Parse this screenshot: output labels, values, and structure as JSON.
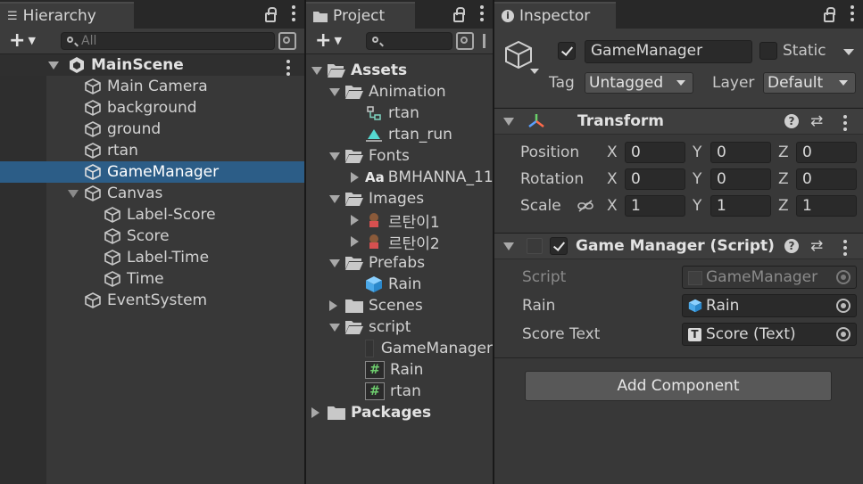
{
  "hierarchy": {
    "tab_title": "Hierarchy",
    "search_placeholder": "All",
    "scene": "MainScene",
    "items": [
      "Main Camera",
      "background",
      "ground",
      "rtan",
      "GameManager",
      "Canvas",
      "Label-Score",
      "Score",
      "Label-Time",
      "Time",
      "EventSystem"
    ],
    "selected": "GameManager",
    "selection_color": "#2c5d87"
  },
  "project": {
    "tab_title": "Project",
    "search_placeholder": "",
    "items": [
      "Assets",
      "Animation",
      "rtan",
      "rtan_run",
      "Fonts",
      "BMHANNA_11",
      "Images",
      "르탄이1",
      "르탄이2",
      "Prefabs",
      "Rain",
      "Scenes",
      "script",
      "GameManager",
      "Rain",
      "rtan",
      "Packages"
    ],
    "font_icon": "Aa"
  },
  "inspector": {
    "tab_title": "Inspector",
    "object_name": "GameManager",
    "static_label": "Static",
    "tag_label": "Tag",
    "tag_value": "Untagged",
    "layer_label": "Layer",
    "layer_value": "Default",
    "transform": {
      "title": "Transform",
      "position_label": "Position",
      "rotation_label": "Rotation",
      "scale_label": "Scale",
      "axis_x": "X",
      "axis_y": "Y",
      "axis_z": "Z",
      "position": [
        "0",
        "0",
        "0"
      ],
      "rotation": [
        "0",
        "0",
        "0"
      ],
      "scale": [
        "1",
        "1",
        "1"
      ]
    },
    "script_component": {
      "title": "Game Manager (Script)",
      "script_label": "Script",
      "script_value": "GameManager",
      "rain_label": "Rain",
      "rain_value": "Rain",
      "score_text_label": "Score Text",
      "score_text_value": "Score (Text)",
      "text_icon": "T"
    },
    "help_icon": "?",
    "add_component": "Add Component"
  }
}
